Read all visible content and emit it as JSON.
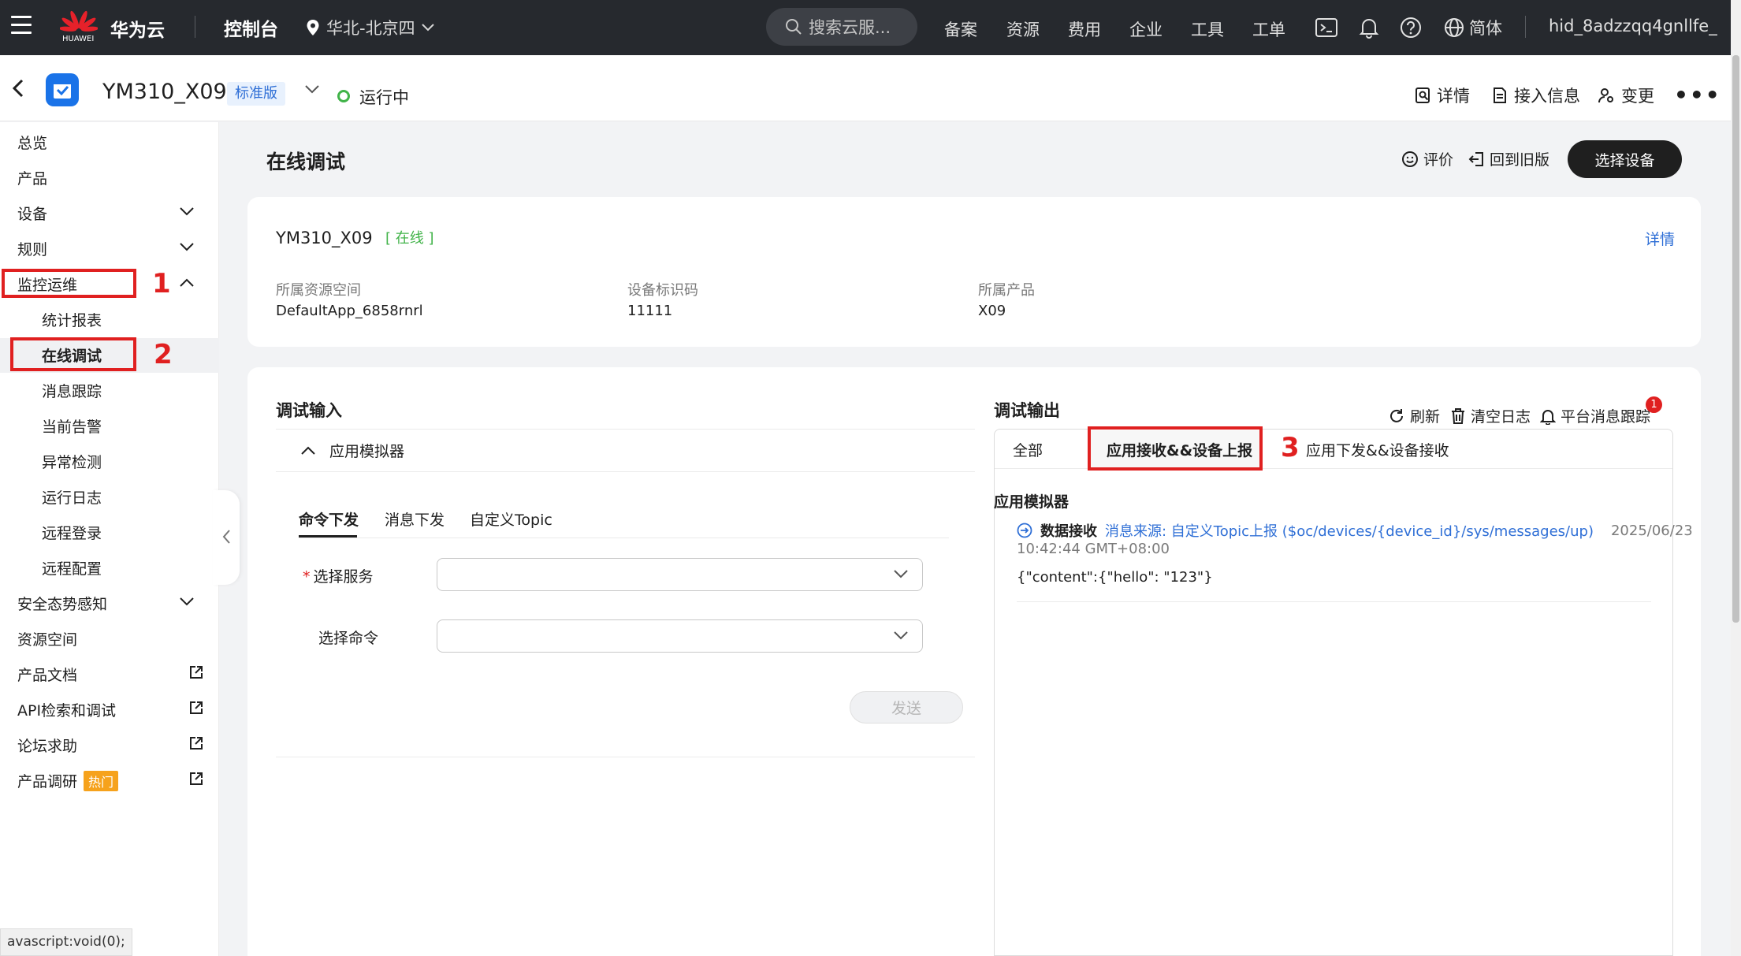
{
  "topbar": {
    "logo_text": "HUAWEI",
    "brand": "华为云",
    "console": "控制台",
    "region": "华北-北京四",
    "search_placeholder": "搜索云服...",
    "nav": [
      "备案",
      "资源",
      "费用",
      "企业",
      "工具",
      "工单"
    ],
    "language": "简体",
    "user": "hid_8adzzqq4gnllfe_"
  },
  "header": {
    "device_title": "YM310_X09",
    "edition_badge": "标准版",
    "status": "运行中",
    "actions": [
      "详情",
      "接入信息",
      "变更"
    ],
    "more": "•••"
  },
  "sidebar": {
    "items": [
      "总览",
      "产品",
      "设备",
      "规则",
      "监控运维"
    ],
    "sub_items": [
      "统计报表",
      "在线调试",
      "消息跟踪",
      "当前告警",
      "异常检测",
      "运行日志",
      "远程登录",
      "远程配置"
    ],
    "items_after": [
      "安全态势感知",
      "资源空间"
    ],
    "external": [
      "产品文档",
      "API检索和调试",
      "论坛求助",
      "产品调研"
    ],
    "hot_badge": "热门"
  },
  "annotations": {
    "n1": "1",
    "n2": "2",
    "n3": "3"
  },
  "page": {
    "title": "在线调试",
    "rate": "评价",
    "old_version": "回到旧版",
    "select_device": "选择设备"
  },
  "device_info": {
    "name": "YM310_X09",
    "online": "[ 在线 ]",
    "detail": "详情",
    "fields": [
      {
        "label": "所属资源空间",
        "value": "DefaultApp_6858rnrl"
      },
      {
        "label": "设备标识码",
        "value": "11111"
      },
      {
        "label": "所属产品",
        "value": "X09"
      }
    ]
  },
  "debug_input": {
    "title": "调试输入",
    "simulator": "应用模拟器",
    "tabs": [
      "命令下发",
      "消息下发",
      "自定义Topic"
    ],
    "service_label": "选择服务",
    "command_label": "选择命令",
    "send": "发送"
  },
  "debug_output": {
    "title": "调试输出",
    "actions": [
      "刷新",
      "清空日志",
      "平台消息跟踪"
    ],
    "notif_count": "1",
    "tabs": [
      "全部",
      "应用接收&&设备上报",
      "应用下发&&设备接收"
    ],
    "log": {
      "section": "应用模拟器",
      "kind": "数据接收",
      "source": "消息来源: 自定义Topic上报 ($oc/devices/{device_id}/sys/messages/up)",
      "date": "2025/06/23",
      "time": "10:42:44 GMT+08:00",
      "body": "{\"content\":{\"hello\": \"123\"}"
    }
  },
  "statusbar": "avascript:void(0);"
}
